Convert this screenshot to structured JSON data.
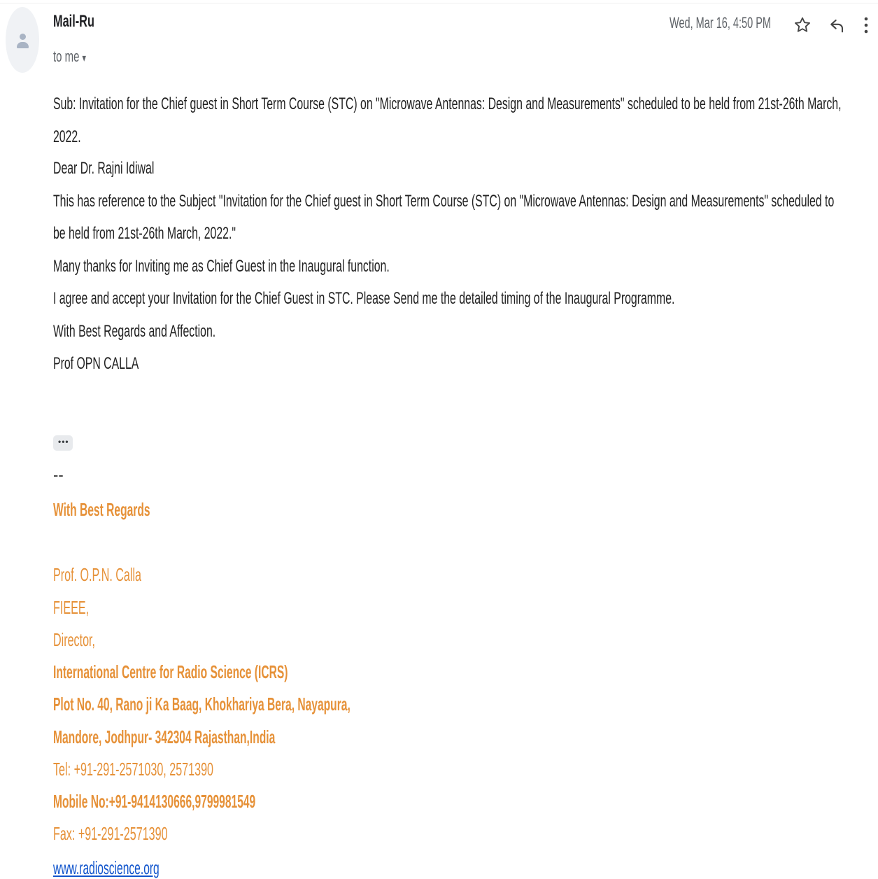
{
  "email": {
    "sender": "Mail-Ru",
    "recipient_label": "to me",
    "recipient_caret": "▾",
    "date": "Wed, Mar 16, 4:50 PM",
    "icons": [
      "star-icon",
      "reply-icon",
      "more-vert-icon"
    ],
    "body_lines": [
      "Sub: Invitation for the Chief guest in Short Term Course (STC) on \"Microwave Antennas: Design and Measurements\" scheduled to be held from 21st-26th March,",
      "2022.",
      " Dear Dr. Rajni Idiwal",
      "      This has reference to the Subject \"Invitation for the Chief guest in Short Term Course (STC) on \"Microwave Antennas: Design and Measurements\" scheduled to",
      "be held from 21st-26th March, 2022.\"",
      "     Many thanks for Inviting me as Chief Guest in the Inaugural function.",
      "    I agree and accept your Invitation for the Chief Guest in STC. Please Send me the detailed timing of the Inaugural Programme.",
      " With Best Regards and Affection.",
      "Prof OPN CALLA"
    ],
    "trimmed_content_label": "•••",
    "signature": {
      "dash": "--",
      "greeting": "With Best Regards",
      "lines": [
        "Prof. O.P.N. Calla",
        "FIEEE,",
        "Director,",
        "International Centre for Radio Science (ICRS)",
        "Plot No. 40, Rano ji Ka Baag, Khokhariya Bera, Nayapura,",
        "Mandore, Jodhpur- 342304 Rajasthan,India",
        "Tel: +91-291-2571030, 2571390",
        "Mobile No:+91-9414130666,9799981549",
        "Fax: +91-291-2571390"
      ],
      "website": "www.radioscience.org"
    }
  }
}
